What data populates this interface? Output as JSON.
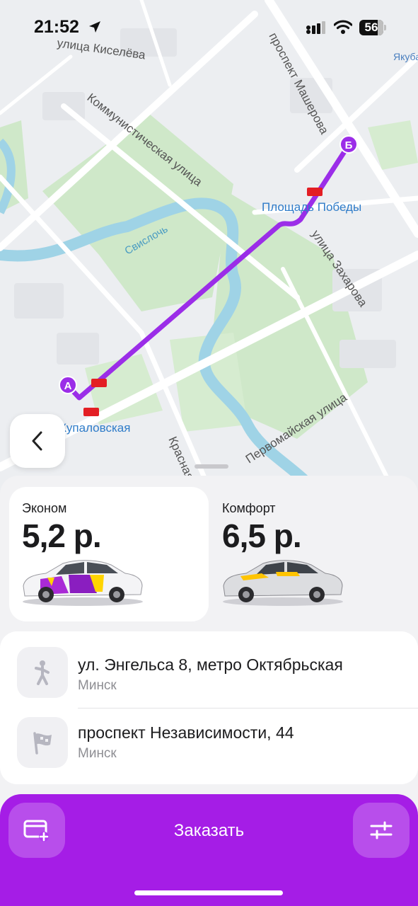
{
  "status_bar": {
    "time": "21:52",
    "battery": "56"
  },
  "map": {
    "streets": {
      "kiseleva": "улица Киселёва",
      "kommunisticheskaya": "Коммунистическая улица",
      "masherova": "проспект Машерова",
      "zakharova": "улица Захарова",
      "pervomayskaya": "Первомайская улица",
      "krasnaya": "Красная",
      "yakub": "Якуба"
    },
    "river": "Свислочь",
    "metro_stations": {
      "pl_pobedy": "Площадь Победы",
      "kupalovskaya": "Купаловская"
    },
    "route_points": {
      "start": "А",
      "end": "Б"
    },
    "route_color": "#9b2de8"
  },
  "tariffs": [
    {
      "name": "Эконом",
      "price": "5,2 р.",
      "selected": true
    },
    {
      "name": "Комфорт",
      "price": "6,5 р.",
      "selected": false
    }
  ],
  "route": {
    "from": {
      "address": "ул. Энгельса 8, метро Октябрьская",
      "city": "Минск"
    },
    "to": {
      "address": "проспект Независимости, 44",
      "city": "Минск"
    }
  },
  "order_button": {
    "label": "Заказать",
    "color": "#a51de6"
  }
}
